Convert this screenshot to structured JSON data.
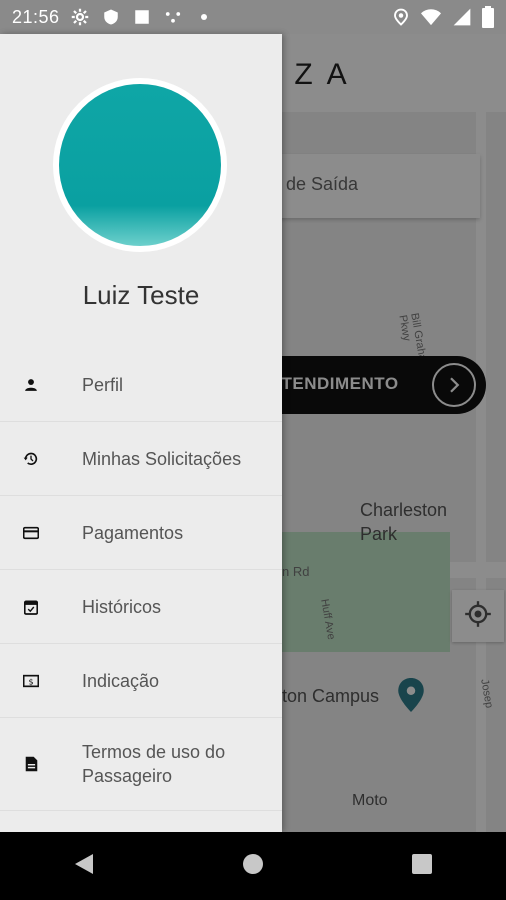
{
  "status_bar": {
    "time": "21:56"
  },
  "app": {
    "brand": "ZZA",
    "origin_placeholder": "de Saída",
    "cta_label": "ATENDIMENTO",
    "map_labels": {
      "park": "Charleston\nPark",
      "campus": "ton Campus",
      "road": "n Rd",
      "street1": "Bill Graham Pkwy",
      "street2": "Huff Ave",
      "street3": "Josep",
      "vehicle": "Moto"
    }
  },
  "drawer": {
    "user_name": "Luiz Teste",
    "items": [
      {
        "label": "Perfil",
        "icon": "person-icon"
      },
      {
        "label": "Minhas Solicitações",
        "icon": "history-icon"
      },
      {
        "label": "Pagamentos",
        "icon": "credit-card-icon"
      },
      {
        "label": "Históricos",
        "icon": "calendar-icon"
      },
      {
        "label": "Indicação",
        "icon": "money-icon"
      },
      {
        "label": "Termos de uso do Passageiro",
        "icon": "document-icon"
      }
    ]
  }
}
